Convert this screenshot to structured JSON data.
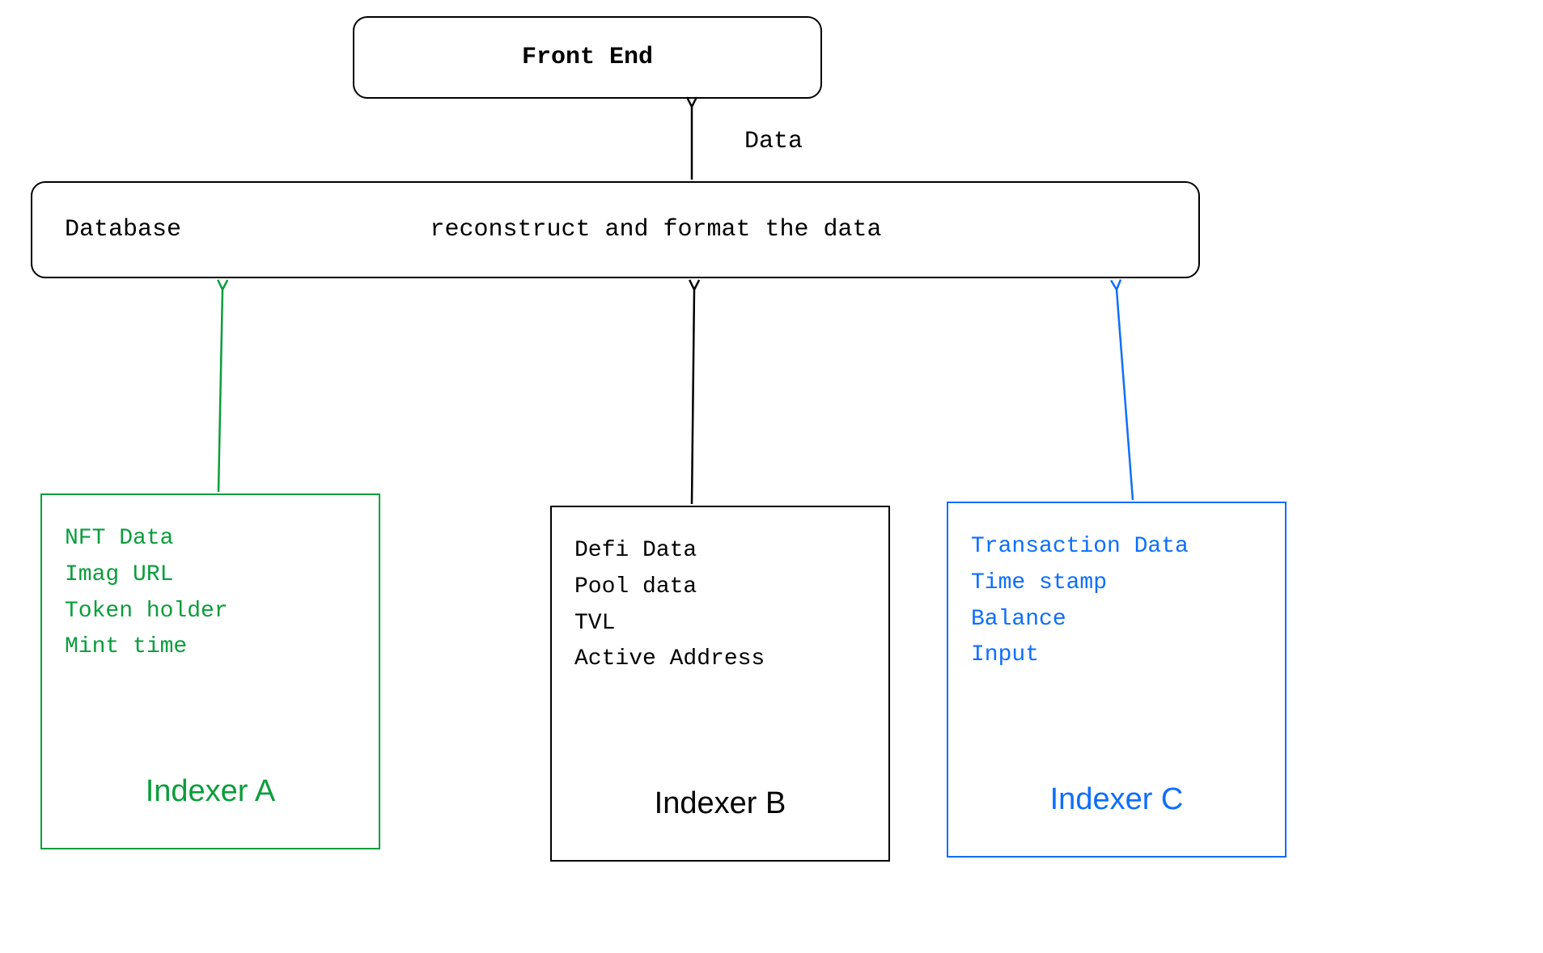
{
  "frontend": {
    "label": "Front End"
  },
  "arrow1": {
    "label": "Data"
  },
  "database": {
    "label": "Database",
    "desc": "reconstruct and format the data"
  },
  "indexers": {
    "a": {
      "title": "Indexer A",
      "lines": [
        "NFT Data",
        "Imag URL",
        "Token holder",
        "Mint time"
      ],
      "color": "#0a9d3b"
    },
    "b": {
      "title": "Indexer B",
      "lines": [
        "Defi Data",
        "Pool data",
        "TVL",
        "Active Address"
      ],
      "color": "#000000"
    },
    "c": {
      "title": "Indexer C",
      "lines": [
        "Transaction Data",
        "Time stamp",
        "Balance",
        "Input"
      ],
      "color": "#0d6efd"
    }
  }
}
